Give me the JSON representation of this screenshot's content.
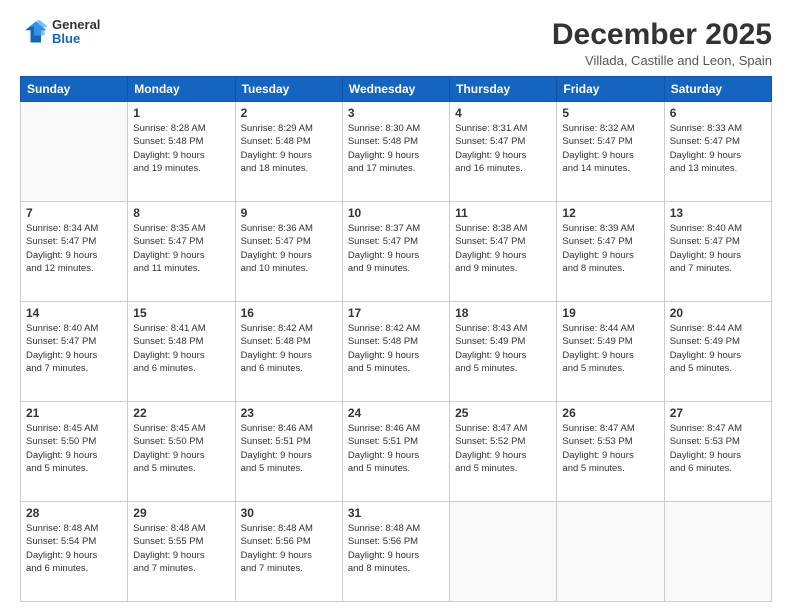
{
  "logo": {
    "general": "General",
    "blue": "Blue"
  },
  "header": {
    "month": "December 2025",
    "location": "Villada, Castille and Leon, Spain"
  },
  "weekdays": [
    "Sunday",
    "Monday",
    "Tuesday",
    "Wednesday",
    "Thursday",
    "Friday",
    "Saturday"
  ],
  "weeks": [
    [
      {
        "day": "",
        "info": ""
      },
      {
        "day": "1",
        "info": "Sunrise: 8:28 AM\nSunset: 5:48 PM\nDaylight: 9 hours\nand 19 minutes."
      },
      {
        "day": "2",
        "info": "Sunrise: 8:29 AM\nSunset: 5:48 PM\nDaylight: 9 hours\nand 18 minutes."
      },
      {
        "day": "3",
        "info": "Sunrise: 8:30 AM\nSunset: 5:48 PM\nDaylight: 9 hours\nand 17 minutes."
      },
      {
        "day": "4",
        "info": "Sunrise: 8:31 AM\nSunset: 5:47 PM\nDaylight: 9 hours\nand 16 minutes."
      },
      {
        "day": "5",
        "info": "Sunrise: 8:32 AM\nSunset: 5:47 PM\nDaylight: 9 hours\nand 14 minutes."
      },
      {
        "day": "6",
        "info": "Sunrise: 8:33 AM\nSunset: 5:47 PM\nDaylight: 9 hours\nand 13 minutes."
      }
    ],
    [
      {
        "day": "7",
        "info": "Sunrise: 8:34 AM\nSunset: 5:47 PM\nDaylight: 9 hours\nand 12 minutes."
      },
      {
        "day": "8",
        "info": "Sunrise: 8:35 AM\nSunset: 5:47 PM\nDaylight: 9 hours\nand 11 minutes."
      },
      {
        "day": "9",
        "info": "Sunrise: 8:36 AM\nSunset: 5:47 PM\nDaylight: 9 hours\nand 10 minutes."
      },
      {
        "day": "10",
        "info": "Sunrise: 8:37 AM\nSunset: 5:47 PM\nDaylight: 9 hours\nand 9 minutes."
      },
      {
        "day": "11",
        "info": "Sunrise: 8:38 AM\nSunset: 5:47 PM\nDaylight: 9 hours\nand 9 minutes."
      },
      {
        "day": "12",
        "info": "Sunrise: 8:39 AM\nSunset: 5:47 PM\nDaylight: 9 hours\nand 8 minutes."
      },
      {
        "day": "13",
        "info": "Sunrise: 8:40 AM\nSunset: 5:47 PM\nDaylight: 9 hours\nand 7 minutes."
      }
    ],
    [
      {
        "day": "14",
        "info": "Sunrise: 8:40 AM\nSunset: 5:47 PM\nDaylight: 9 hours\nand 7 minutes."
      },
      {
        "day": "15",
        "info": "Sunrise: 8:41 AM\nSunset: 5:48 PM\nDaylight: 9 hours\nand 6 minutes."
      },
      {
        "day": "16",
        "info": "Sunrise: 8:42 AM\nSunset: 5:48 PM\nDaylight: 9 hours\nand 6 minutes."
      },
      {
        "day": "17",
        "info": "Sunrise: 8:42 AM\nSunset: 5:48 PM\nDaylight: 9 hours\nand 5 minutes."
      },
      {
        "day": "18",
        "info": "Sunrise: 8:43 AM\nSunset: 5:49 PM\nDaylight: 9 hours\nand 5 minutes."
      },
      {
        "day": "19",
        "info": "Sunrise: 8:44 AM\nSunset: 5:49 PM\nDaylight: 9 hours\nand 5 minutes."
      },
      {
        "day": "20",
        "info": "Sunrise: 8:44 AM\nSunset: 5:49 PM\nDaylight: 9 hours\nand 5 minutes."
      }
    ],
    [
      {
        "day": "21",
        "info": "Sunrise: 8:45 AM\nSunset: 5:50 PM\nDaylight: 9 hours\nand 5 minutes."
      },
      {
        "day": "22",
        "info": "Sunrise: 8:45 AM\nSunset: 5:50 PM\nDaylight: 9 hours\nand 5 minutes."
      },
      {
        "day": "23",
        "info": "Sunrise: 8:46 AM\nSunset: 5:51 PM\nDaylight: 9 hours\nand 5 minutes."
      },
      {
        "day": "24",
        "info": "Sunrise: 8:46 AM\nSunset: 5:51 PM\nDaylight: 9 hours\nand 5 minutes."
      },
      {
        "day": "25",
        "info": "Sunrise: 8:47 AM\nSunset: 5:52 PM\nDaylight: 9 hours\nand 5 minutes."
      },
      {
        "day": "26",
        "info": "Sunrise: 8:47 AM\nSunset: 5:53 PM\nDaylight: 9 hours\nand 5 minutes."
      },
      {
        "day": "27",
        "info": "Sunrise: 8:47 AM\nSunset: 5:53 PM\nDaylight: 9 hours\nand 6 minutes."
      }
    ],
    [
      {
        "day": "28",
        "info": "Sunrise: 8:48 AM\nSunset: 5:54 PM\nDaylight: 9 hours\nand 6 minutes."
      },
      {
        "day": "29",
        "info": "Sunrise: 8:48 AM\nSunset: 5:55 PM\nDaylight: 9 hours\nand 7 minutes."
      },
      {
        "day": "30",
        "info": "Sunrise: 8:48 AM\nSunset: 5:56 PM\nDaylight: 9 hours\nand 7 minutes."
      },
      {
        "day": "31",
        "info": "Sunrise: 8:48 AM\nSunset: 5:56 PM\nDaylight: 9 hours\nand 8 minutes."
      },
      {
        "day": "",
        "info": ""
      },
      {
        "day": "",
        "info": ""
      },
      {
        "day": "",
        "info": ""
      }
    ]
  ]
}
